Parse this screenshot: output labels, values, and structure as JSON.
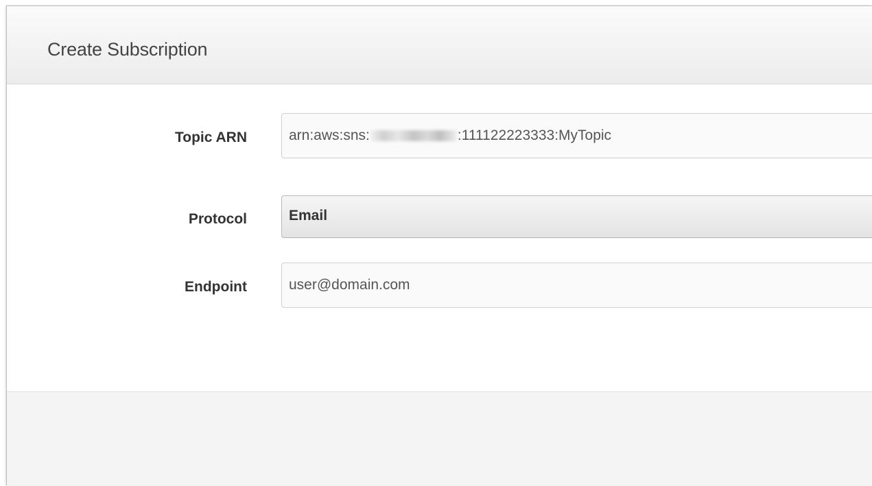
{
  "dialog": {
    "title": "Create Subscription"
  },
  "form": {
    "topic_arn": {
      "label": "Topic ARN",
      "value_prefix": "arn:aws:sns:",
      "value_suffix": ":111122223333:MyTopic"
    },
    "protocol": {
      "label": "Protocol",
      "selected": "Email"
    },
    "endpoint": {
      "label": "Endpoint",
      "value": "user@domain.com"
    }
  }
}
